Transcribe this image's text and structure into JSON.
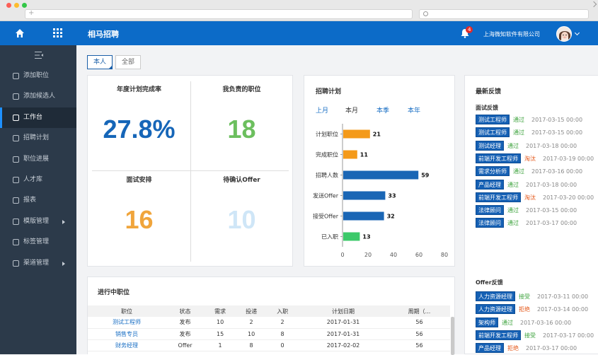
{
  "header": {
    "app_title": "相马招聘",
    "notification_count": "4",
    "company": "上海微知软件有限公司"
  },
  "sidebar": {
    "items": [
      {
        "label": "添加职位"
      },
      {
        "label": "添加候选人"
      },
      {
        "label": "工作台"
      },
      {
        "label": "招聘计划"
      },
      {
        "label": "职位进展"
      },
      {
        "label": "人才库"
      },
      {
        "label": "报表"
      },
      {
        "label": "模版管理"
      },
      {
        "label": "标签管理"
      },
      {
        "label": "渠道管理"
      }
    ]
  },
  "tabs": {
    "mine": "本人",
    "all": "全部"
  },
  "kpis": [
    {
      "label": "年度计划完成率",
      "value": "27.8%",
      "color": "#1666b8"
    },
    {
      "label": "我负责的职位",
      "value": "18",
      "color": "#6cbf5e"
    },
    {
      "label": "面试安排",
      "value": "16",
      "color": "#f0a53c"
    },
    {
      "label": "待确认Offer",
      "value": "10",
      "color": "#cfe6f7"
    }
  ],
  "plan": {
    "title": "招聘计划",
    "periods": [
      "上月",
      "本月",
      "本季",
      "本年"
    ],
    "current_period": "本月"
  },
  "chart_data": {
    "type": "bar",
    "orientation": "horizontal",
    "categories": [
      "计划职位",
      "完成职位",
      "招聘人数",
      "发送Offer",
      "接受Offer",
      "已入职"
    ],
    "values": [
      21,
      11,
      59,
      33,
      32,
      13
    ],
    "colors": [
      "#f49a1a",
      "#f49a1a",
      "#1a66b5",
      "#1a66b5",
      "#1a66b5",
      "#3cc96a"
    ],
    "xticks": [
      0,
      20,
      40,
      60,
      80
    ],
    "xlim": [
      0,
      80
    ]
  },
  "feedback": {
    "title": "最新反馈",
    "interview_label": "面试反馈",
    "interview": [
      {
        "job": "测试工程师",
        "status": "通过",
        "type": "pass",
        "time": "2017-03-15 00:00"
      },
      {
        "job": "测试工程师",
        "status": "通过",
        "type": "pass",
        "time": "2017-03-15 00:00"
      },
      {
        "job": "测试经理",
        "status": "通过",
        "type": "pass",
        "time": "2017-03-18 00:00"
      },
      {
        "job": "前端开发工程师",
        "status": "淘汰",
        "type": "fail",
        "time": "2017-03-19 00:00"
      },
      {
        "job": "需求分析师",
        "status": "通过",
        "type": "pass",
        "time": "2017-03-16 00:00"
      },
      {
        "job": "产品经理",
        "status": "通过",
        "type": "pass",
        "time": "2017-03-18 00:00"
      },
      {
        "job": "前端开发工程师",
        "status": "淘汰",
        "type": "fail",
        "time": "2017-03-20 00:00"
      },
      {
        "job": "法律顾问",
        "status": "通过",
        "type": "pass",
        "time": "2017-03-15 00:00"
      },
      {
        "job": "法律顾问",
        "status": "通过",
        "type": "pass",
        "time": "2017-03-17 00:00"
      }
    ],
    "offer_label": "Offer反馈",
    "offer": [
      {
        "job": "人力资源经理",
        "status": "接受",
        "type": "pass",
        "time": "2017-03-11 00:00"
      },
      {
        "job": "人力资源经理",
        "status": "拒绝",
        "type": "fail",
        "time": "2017-03-14 00:00"
      },
      {
        "job": "架构师",
        "status": "通过",
        "type": "pass",
        "time": "2017-03-16 00:00"
      },
      {
        "job": "前端开发工程师",
        "status": "接受",
        "type": "pass",
        "time": "2017-03-17 00:00"
      },
      {
        "job": "产品经理",
        "status": "拒绝",
        "type": "fail",
        "time": "2017-03-17 00:00"
      }
    ]
  },
  "jobs": {
    "title": "进行中职位",
    "columns": [
      "职位",
      "状态",
      "需求",
      "投递",
      "入职",
      "计划日期",
      "周期（..."
    ],
    "rows": [
      [
        "测试工程师",
        "发布",
        "10",
        "2",
        "2",
        "2017-01-31",
        "56"
      ],
      [
        "销售专员",
        "发布",
        "15",
        "10",
        "8",
        "2017-01-31",
        "56"
      ],
      [
        "财务经理",
        "Offer",
        "1",
        "8",
        "0",
        "2017-02-02",
        "56"
      ]
    ]
  }
}
